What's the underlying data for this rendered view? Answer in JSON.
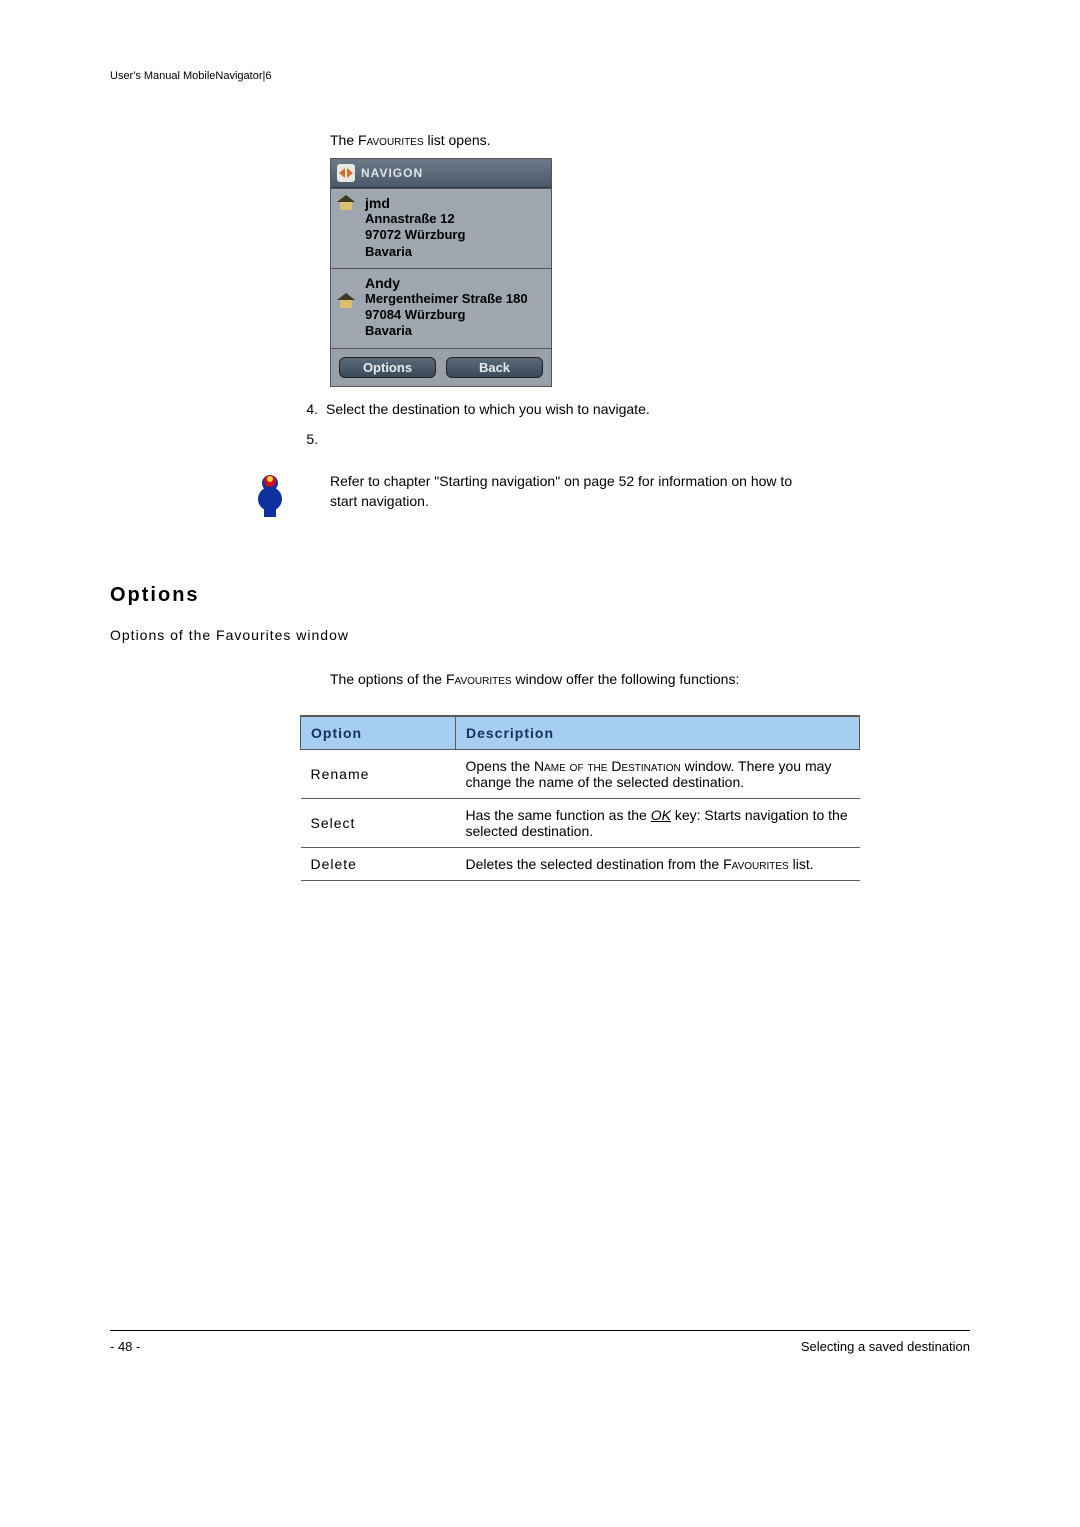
{
  "header": {
    "text": "User's Manual MobileNavigator|6"
  },
  "intro": {
    "prefix": "The ",
    "favourites": "Favourites",
    "suffix": " list opens."
  },
  "device": {
    "brand": "NAVIGON",
    "items": [
      {
        "name": "jmd",
        "lines": [
          "Annastraße 12",
          "97072 Würzburg",
          "Bavaria"
        ]
      },
      {
        "name": "Andy",
        "lines": [
          "Mergentheimer Straße 180",
          "97084 Würzburg",
          "Bavaria"
        ]
      }
    ],
    "softkeys": {
      "left": "Options",
      "right": "Back"
    }
  },
  "steps": {
    "s4": {
      "num": "4.",
      "text": "Select the destination to which you wish to navigate."
    },
    "s5": {
      "num": "5."
    }
  },
  "note": {
    "text": "Refer to chapter \"Starting navigation\" on page 52 for information on how to start navigation."
  },
  "headings": {
    "options": "Options",
    "sub": "Options of the Favourites window"
  },
  "options_intro": {
    "prefix": "The options of the ",
    "favourites": "Favourites",
    "suffix": " window offer the following functions:"
  },
  "table": {
    "head": {
      "option": "Option",
      "description": "Description"
    },
    "rows": {
      "rename": {
        "name": "Rename",
        "desc_prefix": "Opens the ",
        "desc_smallcaps": "Name of the Destination",
        "desc_suffix": " window. There you may change the name of the selected destination."
      },
      "select": {
        "name": "Select",
        "desc_prefix": "Has the same function as the ",
        "ok": "OK",
        "desc_suffix": " key: Starts navigation to the selected destination."
      },
      "delete": {
        "name": "Delete",
        "desc_prefix": "Deletes the selected destination from the ",
        "favourites": "Favourites",
        "desc_suffix": " list."
      }
    }
  },
  "footer": {
    "page": "- 48 -",
    "section": "Selecting a saved destination"
  }
}
